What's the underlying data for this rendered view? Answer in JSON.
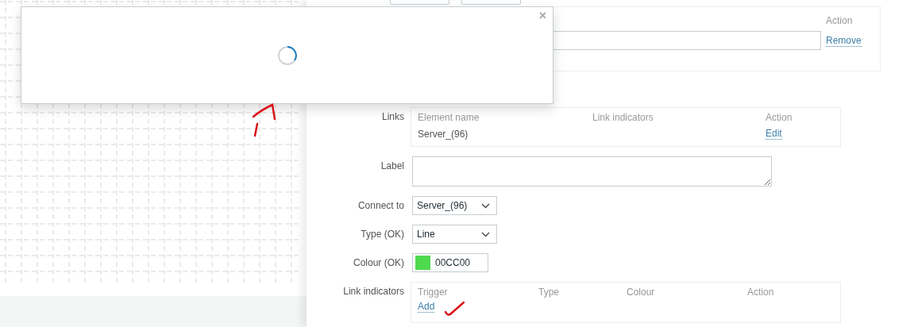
{
  "modal": {
    "close": "×",
    "loading": true
  },
  "elements_table": {
    "columns": [
      "Action"
    ],
    "rows": [
      {
        "action": "Remove"
      }
    ]
  },
  "links": {
    "label": "Links",
    "columns": [
      "Element name",
      "Link indicators",
      "Action"
    ],
    "rows": [
      {
        "element_name": "Server_(96)",
        "action": "Edit"
      }
    ]
  },
  "fields": [
    {
      "kind": "textarea",
      "label": "Label"
    },
    {
      "kind": "select",
      "label": "Connect to",
      "value": "Server_(96)"
    },
    {
      "kind": "select",
      "label": "Type (OK)",
      "value": "Line"
    },
    {
      "kind": "color",
      "label": "Colour (OK)",
      "value": "00CC00",
      "color": "#4fd94f"
    }
  ],
  "link_indicators": {
    "label": "Link indicators",
    "columns": [
      "Trigger",
      "Type",
      "Colour",
      "Action"
    ],
    "add": "Add"
  }
}
